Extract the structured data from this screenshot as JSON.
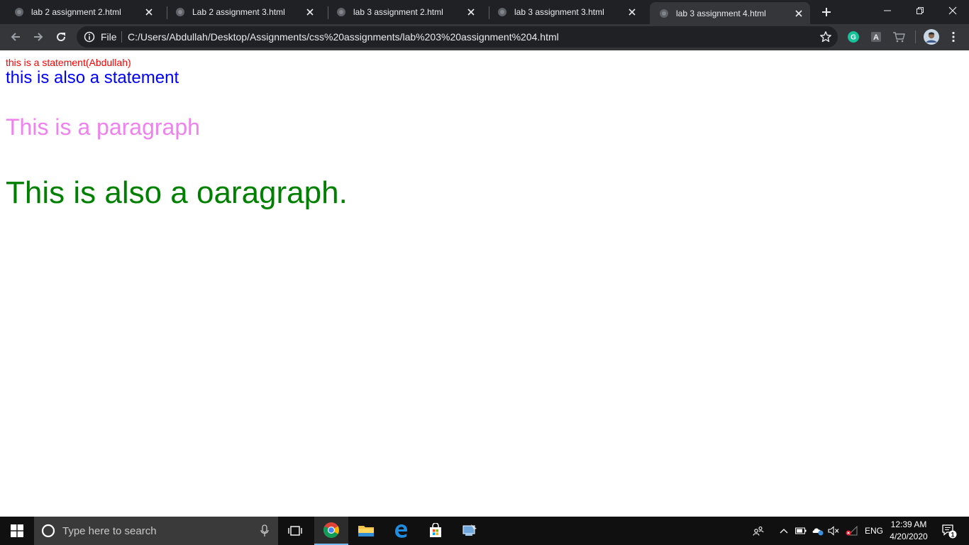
{
  "browser": {
    "tabs": [
      {
        "title": "lab 2 assignment 2.html",
        "active": false
      },
      {
        "title": "Lab 2 assignment 3.html",
        "active": false
      },
      {
        "title": "lab 3 assignment 2.html",
        "active": false
      },
      {
        "title": "lab 3 assignment 3.html",
        "active": false
      },
      {
        "title": "lab 3 assignment 4.html",
        "active": true
      }
    ],
    "omnibox": {
      "scheme_label": "File",
      "url": "C:/Users/Abdullah/Desktop/Assignments/css%20assignments/lab%203%20assignment%204.html"
    },
    "extensions": [
      {
        "icon": "grammarly-icon",
        "glyph": "G",
        "color": "#15c39a"
      },
      {
        "icon": "translate-icon",
        "glyph": "A",
        "color": "#bdc1c6"
      },
      {
        "icon": "cart-icon",
        "glyph": "",
        "color": "#9aa0a6"
      }
    ],
    "colors": {
      "tabstrip": "#202124",
      "toolbar": "#35363a",
      "omnibox": "#202124",
      "text": "#e8eaed"
    }
  },
  "page": {
    "statement_small": "this is a statement(Abdullah)",
    "statement_large": "this is also a statement",
    "paragraph_1": "This is a paragraph",
    "paragraph_2": "This is also a oaragraph.",
    "colors": {
      "statement_small": "#ff0000",
      "statement_large": "#0000ff",
      "paragraph_1": "#ee82ee",
      "paragraph_2": "#008000"
    }
  },
  "taskbar": {
    "search_placeholder": "Type here to search",
    "apps": [
      "task-view-icon",
      "chrome-icon",
      "file-explorer-icon",
      "edge-icon",
      "store-icon",
      "network-app-icon"
    ],
    "language": "ENG",
    "time": "12:39 AM",
    "date": "4/20/2020",
    "notification_count": "1"
  }
}
